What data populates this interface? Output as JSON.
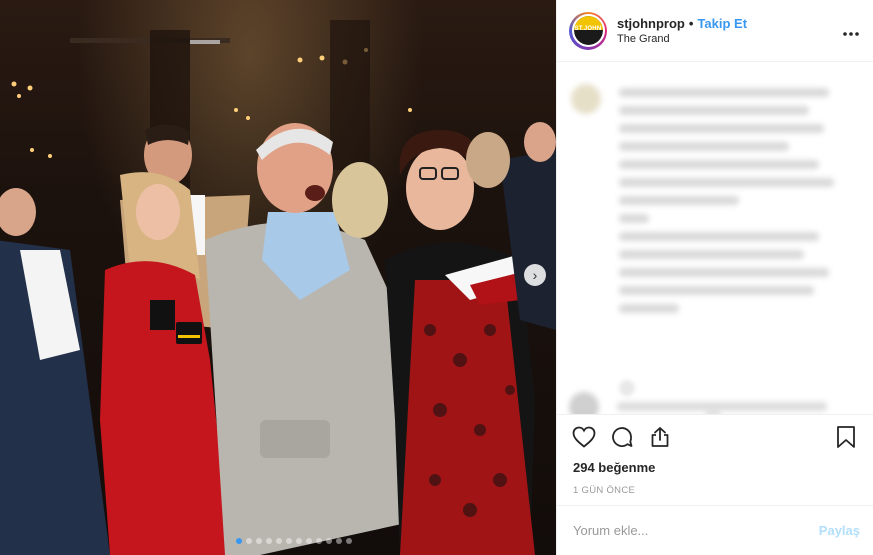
{
  "post": {
    "username": "stjohnprop",
    "separator": "•",
    "follow_label": "Takip Et",
    "location": "The Grand",
    "avatar_logo_text": "ST.JOHN",
    "more_icon": "more-options-icon",
    "likes_text": "294 beğenme",
    "timestamp": "1 GÜN ÖNCE",
    "comment_placeholder": "Yorum ekle...",
    "share_label": "Paylaş",
    "carousel": {
      "total": 12,
      "active_index": 0,
      "next_icon": "chevron-right-icon",
      "next_glyph": "›"
    }
  },
  "actions": {
    "like_icon": "heart-icon",
    "comment_icon": "comment-icon",
    "share_icon": "share-icon",
    "save_icon": "bookmark-icon"
  },
  "colors": {
    "accent": "#3897f0",
    "share_disabled": "#b2dffc",
    "muted_text": "#999999",
    "dress_red": "#c4161c",
    "jacket_gray": "#b9b6b0"
  }
}
